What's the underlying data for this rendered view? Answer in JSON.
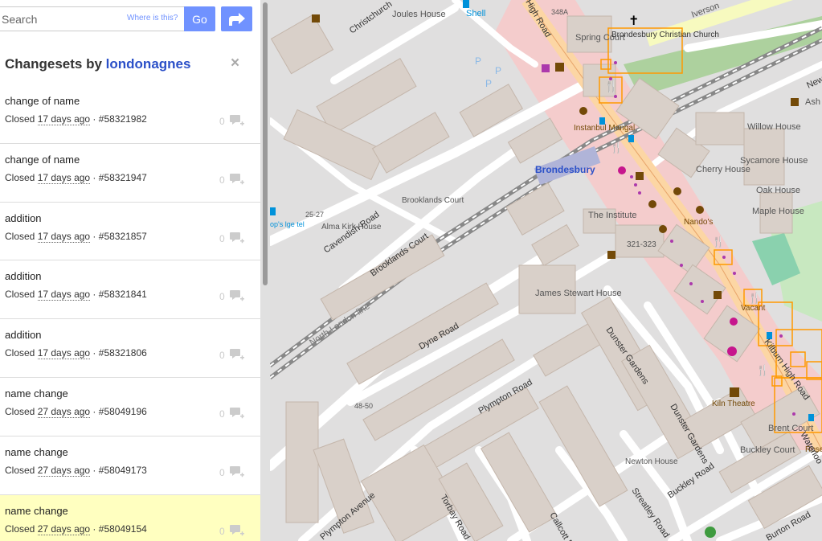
{
  "search": {
    "placeholder": "Search",
    "where_link": "Where is this?",
    "go_label": "Go"
  },
  "changesets": {
    "title_prefix": "Changesets by",
    "username": "londonagnes",
    "close_symbol": "×",
    "items": [
      {
        "comment": "change of name",
        "status": "Closed",
        "time": "17 days ago",
        "id": "#58321982",
        "comments": "0",
        "highlight": false
      },
      {
        "comment": "change of name",
        "status": "Closed",
        "time": "17 days ago",
        "id": "#58321947",
        "comments": "0",
        "highlight": false
      },
      {
        "comment": "addition",
        "status": "Closed",
        "time": "17 days ago",
        "id": "#58321857",
        "comments": "0",
        "highlight": false
      },
      {
        "comment": "addition",
        "status": "Closed",
        "time": "17 days ago",
        "id": "#58321841",
        "comments": "0",
        "highlight": false
      },
      {
        "comment": "addition",
        "status": "Closed",
        "time": "17 days ago",
        "id": "#58321806",
        "comments": "0",
        "highlight": false
      },
      {
        "comment": "name change",
        "status": "Closed",
        "time": "27 days ago",
        "id": "#58049196",
        "comments": "0",
        "highlight": false
      },
      {
        "comment": "name change",
        "status": "Closed",
        "time": "27 days ago",
        "id": "#58049173",
        "comments": "0",
        "highlight": false
      },
      {
        "comment": "name change",
        "status": "Closed",
        "time": "27 days ago",
        "id": "#58049154",
        "comments": "0",
        "highlight": true
      }
    ]
  },
  "map": {
    "labels": {
      "shell": "Shell",
      "joules_house": "Joules House",
      "spring_court": "Spring Court",
      "church": "Brondesbury Christian Church",
      "iverson": "Iverson",
      "brondesbury": "Brondesbury",
      "instanbul_mangal": "Instanbul Mangal",
      "cherry_house": "Cherry House",
      "willow_house": "Willow House",
      "sycamore_house": "Sycamore House",
      "oak_house": "Oak House",
      "maple_house": "Maple House",
      "ash": "Ash",
      "the_institute": "The Institute",
      "nandos": "Nando's",
      "addr_321": "321-323",
      "brooklands_court": "Brooklands Court",
      "alma_kirk": "Alma Kirk House",
      "addr_2527": "25-27",
      "cavendish_road": "Cavendish Road",
      "brooklands_court_road": "Brooklands Court",
      "north_london_line": "North London line",
      "james_stewart": "James Stewart House",
      "dyne_road": "Dyne Road",
      "dunster_gardens": "Dunster Gardens",
      "dunster_gardens2": "Dunster Gardens",
      "kilburn_high_road": "Kilburn High Road",
      "vacant": "Vacant",
      "kiln_theatre": "Kiln Theatre",
      "brent_court": "Brent Court",
      "rose": "Rose",
      "buckley_court": "Buckley Court",
      "buckley_road": "Buckley Road",
      "plympton_road": "Plympton Road",
      "plympton_avenue": "Plympton Avenue",
      "torbay_road": "Torbay Road",
      "callcott": "Callcott R",
      "streatley_road": "Streatley Road",
      "newton_house": "Newton House",
      "burton_road": "Burton Road",
      "waterloo": "Waterloo",
      "christchurch": "Christchurch",
      "high_road": "High Road",
      "new": "New",
      "op_lodge": "op's lge tel",
      "addr_4850": "48-50",
      "addr_348a": "348A"
    }
  }
}
